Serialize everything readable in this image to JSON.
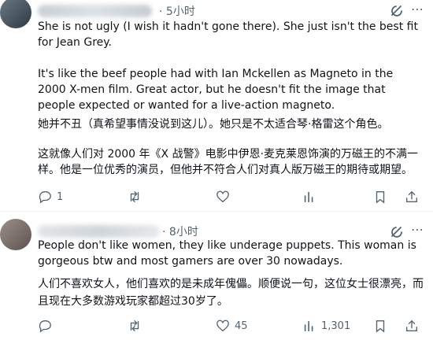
{
  "comment1": {
    "time": "5小时",
    "body_en_1": "She is not ugly (I wish it hadn't gone there). She just isn't the best fit for Jean Grey.",
    "body_en_2": "It's like the beef people had with Ian Mckellen as Magneto in the 2000 X-men film. Great actor, but he doesn't fit the image that people expected or wanted for a live-action magneto.",
    "body_cn_1": "她并不丑（真希望事情没说到这儿）。她只是不太适合琴·格雷这个角色。",
    "body_cn_2": "这就像人们对 2000 年《X 战警》电影中伊恩·麦克莱恩饰演的万磁王的不满一样。他是一位优秀的演员，但他并不符合人们对真人版万磁王的期待或期望。",
    "replies": "1"
  },
  "comment2": {
    "time": "8小时",
    "body_en": "People don't like women, they like underage puppets. This woman is gorgeous btw and most gamers are over 30 nowadays.",
    "body_cn": "人们不喜欢女人，他们喜欢的是未成年傀儡。顺便说一句，这位女士很漂亮，而且现在大多数游戏玩家都超过30岁了。",
    "likes": "45",
    "views": "1,301"
  },
  "icons": [
    "reply-icon",
    "repost-icon",
    "like-icon",
    "views-icon",
    "bookmark-icon",
    "share-icon",
    "grok-icon",
    "more-icon"
  ]
}
